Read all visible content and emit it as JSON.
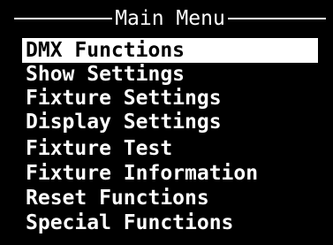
{
  "menu": {
    "title": "Main Menu",
    "selected_index": 0,
    "items": [
      {
        "label": "DMX Functions"
      },
      {
        "label": "Show Settings"
      },
      {
        "label": "Fixture Settings"
      },
      {
        "label": "Display Settings"
      },
      {
        "label": "Fixture Test"
      },
      {
        "label": "Fixture Information"
      },
      {
        "label": "Reset Functions"
      },
      {
        "label": "Special Functions"
      }
    ]
  },
  "colors": {
    "background": "#000000",
    "text": "#ffffff",
    "highlight_background": "#ffffff",
    "highlight_text": "#000000"
  }
}
